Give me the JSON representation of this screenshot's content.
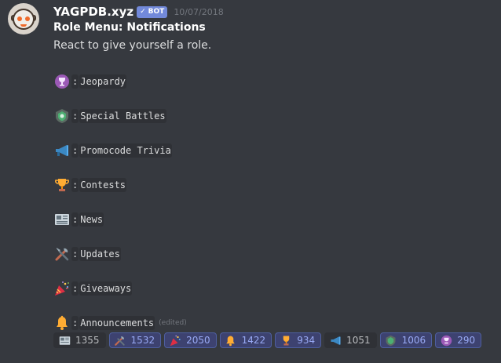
{
  "message": {
    "username": "YAGPDB.xyz",
    "bot_tag": "BOT",
    "bot_check": "✓",
    "timestamp": "10/07/2018",
    "title": "Role Menu: Notifications",
    "subtitle": "React to give yourself a role.",
    "edited": "(edited)",
    "separator": ":",
    "roles": [
      {
        "icon": "trophy-badge-icon",
        "label": "Jeopardy"
      },
      {
        "icon": "battle-emblem-icon",
        "label": "Special Battles"
      },
      {
        "icon": "megaphone-icon",
        "label": "Promocode Trivia"
      },
      {
        "icon": "trophy-icon",
        "label": "Contests"
      },
      {
        "icon": "newspaper-icon",
        "label": "News"
      },
      {
        "icon": "tools-icon",
        "label": "Updates"
      },
      {
        "icon": "party-popper-icon",
        "label": "Giveaways"
      },
      {
        "icon": "bell-icon",
        "label": "Announcements"
      }
    ]
  },
  "reactions": [
    {
      "icon": "newspaper-icon",
      "count": "1355",
      "reacted": false
    },
    {
      "icon": "tools-icon",
      "count": "1532",
      "reacted": true
    },
    {
      "icon": "party-popper-icon",
      "count": "2050",
      "reacted": true
    },
    {
      "icon": "bell-icon",
      "count": "1422",
      "reacted": true
    },
    {
      "icon": "trophy-icon",
      "count": "934",
      "reacted": true
    },
    {
      "icon": "megaphone-icon",
      "count": "1051",
      "reacted": false
    },
    {
      "icon": "battle-emblem-icon",
      "count": "1006",
      "reacted": true
    },
    {
      "icon": "trophy-badge-icon",
      "count": "290",
      "reacted": true
    }
  ],
  "colors": {
    "background": "#36393f",
    "bot_tag": "#7289da",
    "reaction_me_bg": "#3d4270",
    "reaction_bg": "#2f3136"
  }
}
